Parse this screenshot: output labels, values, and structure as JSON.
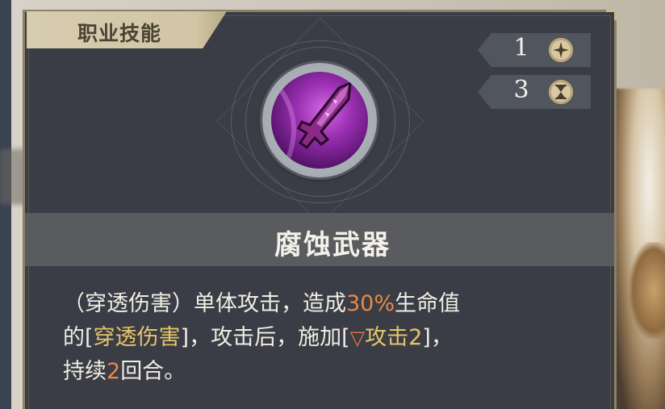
{
  "tab": {
    "label": "职业技能"
  },
  "stats": [
    {
      "value": "1",
      "icon": "sparkle-star-icon"
    },
    {
      "value": "3",
      "icon": "hourglass-icon"
    }
  ],
  "skill": {
    "icon": "corroded-sword-icon",
    "name": "腐蚀武器"
  },
  "description": {
    "seg1": "（穿透伤害）单体攻击，造成",
    "percent": "30%",
    "seg2": "生命值",
    "seg3": "的[",
    "damage_type": "穿透伤害",
    "seg4": "]，攻击后，施加[",
    "debuff_label": "攻击2",
    "seg5": "]，",
    "seg6": "持续",
    "duration": "2",
    "seg7": "回合。"
  },
  "colors": {
    "highlight_number": "#e98945",
    "highlight_keyword": "#e7c46a",
    "panel": "#3a3d45",
    "tab": "#d7ccaf"
  }
}
